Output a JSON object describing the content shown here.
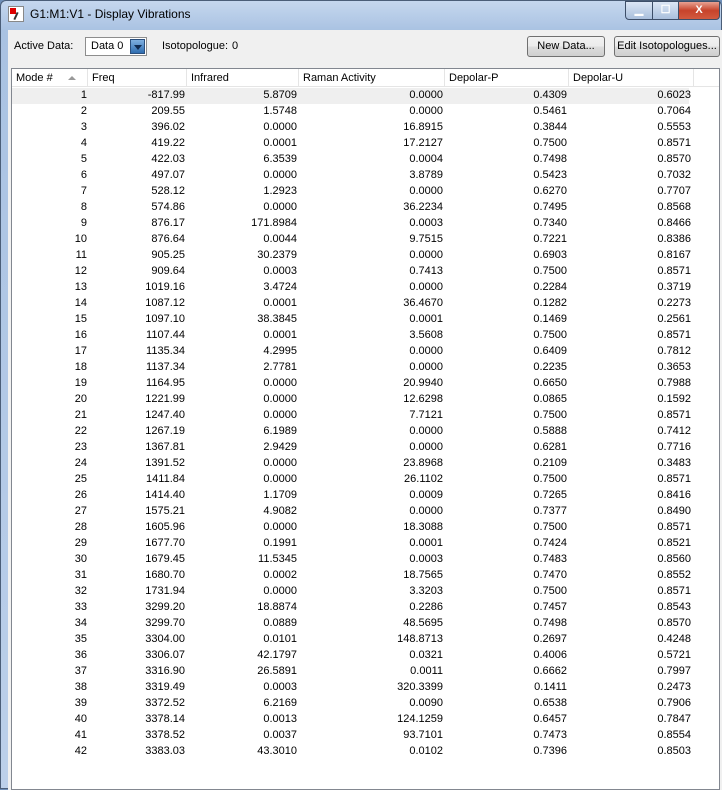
{
  "window": {
    "title": "G1:M1:V1 - Display Vibrations"
  },
  "toolbar": {
    "active_data_label": "Active Data:",
    "active_data_value": "Data 0",
    "isotopologue_label": "Isotopologue:",
    "isotopologue_value": "0",
    "new_data_label": "New Data...",
    "edit_isotopologues_label": "Edit Isotopologues..."
  },
  "table": {
    "columns": [
      "Mode #",
      "Freq",
      "Infrared",
      "Raman Activity",
      "Depolar-P",
      "Depolar-U"
    ],
    "selected_row": 1,
    "rows": [
      [
        "1",
        "-817.99",
        "5.8709",
        "0.0000",
        "0.4309",
        "0.6023"
      ],
      [
        "2",
        "209.55",
        "1.5748",
        "0.0000",
        "0.5461",
        "0.7064"
      ],
      [
        "3",
        "396.02",
        "0.0000",
        "16.8915",
        "0.3844",
        "0.5553"
      ],
      [
        "4",
        "419.22",
        "0.0001",
        "17.2127",
        "0.7500",
        "0.8571"
      ],
      [
        "5",
        "422.03",
        "6.3539",
        "0.0004",
        "0.7498",
        "0.8570"
      ],
      [
        "6",
        "497.07",
        "0.0000",
        "3.8789",
        "0.5423",
        "0.7032"
      ],
      [
        "7",
        "528.12",
        "1.2923",
        "0.0000",
        "0.6270",
        "0.7707"
      ],
      [
        "8",
        "574.86",
        "0.0000",
        "36.2234",
        "0.7495",
        "0.8568"
      ],
      [
        "9",
        "876.17",
        "171.8984",
        "0.0003",
        "0.7340",
        "0.8466"
      ],
      [
        "10",
        "876.64",
        "0.0044",
        "9.7515",
        "0.7221",
        "0.8386"
      ],
      [
        "11",
        "905.25",
        "30.2379",
        "0.0000",
        "0.6903",
        "0.8167"
      ],
      [
        "12",
        "909.64",
        "0.0003",
        "0.7413",
        "0.7500",
        "0.8571"
      ],
      [
        "13",
        "1019.16",
        "3.4724",
        "0.0000",
        "0.2284",
        "0.3719"
      ],
      [
        "14",
        "1087.12",
        "0.0001",
        "36.4670",
        "0.1282",
        "0.2273"
      ],
      [
        "15",
        "1097.10",
        "38.3845",
        "0.0001",
        "0.1469",
        "0.2561"
      ],
      [
        "16",
        "1107.44",
        "0.0001",
        "3.5608",
        "0.7500",
        "0.8571"
      ],
      [
        "17",
        "1135.34",
        "4.2995",
        "0.0000",
        "0.6409",
        "0.7812"
      ],
      [
        "18",
        "1137.34",
        "2.7781",
        "0.0000",
        "0.2235",
        "0.3653"
      ],
      [
        "19",
        "1164.95",
        "0.0000",
        "20.9940",
        "0.6650",
        "0.7988"
      ],
      [
        "20",
        "1221.99",
        "0.0000",
        "12.6298",
        "0.0865",
        "0.1592"
      ],
      [
        "21",
        "1247.40",
        "0.0000",
        "7.7121",
        "0.7500",
        "0.8571"
      ],
      [
        "22",
        "1267.19",
        "6.1989",
        "0.0000",
        "0.5888",
        "0.7412"
      ],
      [
        "23",
        "1367.81",
        "2.9429",
        "0.0000",
        "0.6281",
        "0.7716"
      ],
      [
        "24",
        "1391.52",
        "0.0000",
        "23.8968",
        "0.2109",
        "0.3483"
      ],
      [
        "25",
        "1411.84",
        "0.0000",
        "26.1102",
        "0.7500",
        "0.8571"
      ],
      [
        "26",
        "1414.40",
        "1.1709",
        "0.0009",
        "0.7265",
        "0.8416"
      ],
      [
        "27",
        "1575.21",
        "4.9082",
        "0.0000",
        "0.7377",
        "0.8490"
      ],
      [
        "28",
        "1605.96",
        "0.0000",
        "18.3088",
        "0.7500",
        "0.8571"
      ],
      [
        "29",
        "1677.70",
        "0.1991",
        "0.0001",
        "0.7424",
        "0.8521"
      ],
      [
        "30",
        "1679.45",
        "11.5345",
        "0.0003",
        "0.7483",
        "0.8560"
      ],
      [
        "31",
        "1680.70",
        "0.0002",
        "18.7565",
        "0.7470",
        "0.8552"
      ],
      [
        "32",
        "1731.94",
        "0.0000",
        "3.3203",
        "0.7500",
        "0.8571"
      ],
      [
        "33",
        "3299.20",
        "18.8874",
        "0.2286",
        "0.7457",
        "0.8543"
      ],
      [
        "34",
        "3299.70",
        "0.0889",
        "48.5695",
        "0.7498",
        "0.8570"
      ],
      [
        "35",
        "3304.00",
        "0.0101",
        "148.8713",
        "0.2697",
        "0.4248"
      ],
      [
        "36",
        "3306.07",
        "42.1797",
        "0.0321",
        "0.4006",
        "0.5721"
      ],
      [
        "37",
        "3316.90",
        "26.5891",
        "0.0011",
        "0.6662",
        "0.7997"
      ],
      [
        "38",
        "3319.49",
        "0.0003",
        "320.3399",
        "0.1411",
        "0.2473"
      ],
      [
        "39",
        "3372.52",
        "6.2169",
        "0.0090",
        "0.6538",
        "0.7906"
      ],
      [
        "40",
        "3378.14",
        "0.0013",
        "124.1259",
        "0.6457",
        "0.7847"
      ],
      [
        "41",
        "3378.52",
        "0.0037",
        "93.7101",
        "0.7473",
        "0.8554"
      ],
      [
        "42",
        "3383.03",
        "43.3010",
        "0.0102",
        "0.7396",
        "0.8503"
      ]
    ]
  }
}
